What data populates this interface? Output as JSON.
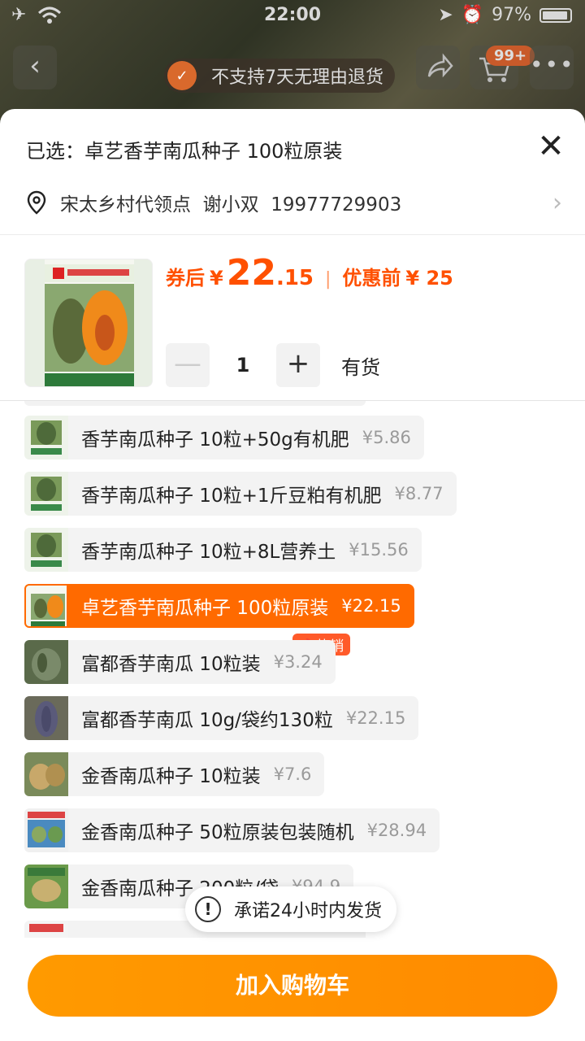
{
  "status_bar": {
    "time": "22:00",
    "battery": "97%"
  },
  "top_nav": {
    "return_policy": "不支持7天无理由退货",
    "cart_badge": "99+"
  },
  "sheet": {
    "selected_label": "已选：卓艺香芋南瓜种子 100粒原装",
    "address": "宋太乡村代领点  谢小双  19977729903",
    "price": {
      "after_coupon_label": "券后",
      "currency": "¥",
      "integer": "22",
      "decimal": ".15",
      "before_label": "优惠前",
      "before_value": "¥ 25"
    },
    "quantity": {
      "minus": "—",
      "value": "1",
      "plus": "+",
      "stock": "有货"
    },
    "options": [
      {
        "label": "香芋南瓜种子 10粒+50g有机肥",
        "price": "¥5.86",
        "selected": false
      },
      {
        "label": "香芋南瓜种子 10粒+1斤豆粕有机肥",
        "price": "¥8.77",
        "selected": false
      },
      {
        "label": "香芋南瓜种子 10粒+8L营养土",
        "price": "¥15.56",
        "selected": false
      },
      {
        "label": "卓艺香芋南瓜种子 100粒原装",
        "price": "¥22.15",
        "selected": true
      },
      {
        "label": "富都香芋南瓜 10粒装",
        "price": "¥3.24",
        "selected": false,
        "badge": "热销"
      },
      {
        "label": "富都香芋南瓜 10g/袋约130粒",
        "price": "¥22.15",
        "selected": false
      },
      {
        "label": "金香南瓜种子 10粒装",
        "price": "¥7.6",
        "selected": false
      },
      {
        "label": "金香南瓜种子 50粒原装包装随机",
        "price": "¥28.94",
        "selected": false
      },
      {
        "label": "金香南瓜种子 200粒/袋",
        "price": "¥94.9",
        "selected": false
      }
    ],
    "promise": "承诺24小时内发货",
    "add_to_cart": "加入购物车"
  },
  "colors": {
    "accent": "#ff6a00",
    "price": "#ff5000",
    "button": "#ff9000"
  }
}
